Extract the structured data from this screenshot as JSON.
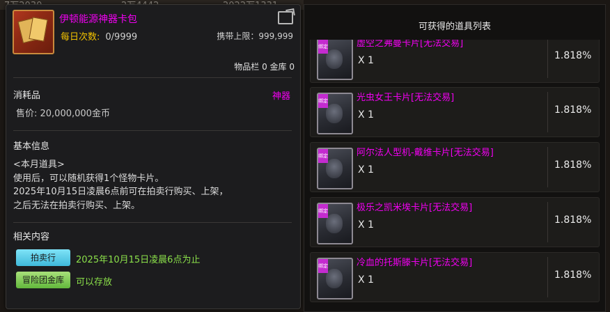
{
  "top_strip": [
    "7万2030",
    "2万4442",
    "2022万1331"
  ],
  "tooltip": {
    "item_name": "伊顿能源神器卡包",
    "item_icon": "card-pack-icon",
    "daily_label": "每日次数:",
    "daily_value": "0/9999",
    "carry_limit": "携带上限：999,999",
    "storage": "物品栏 0 金库 0",
    "category": "消耗品",
    "tag": "神器",
    "price": "售价: 20,000,000金币",
    "basic_info_title": "基本信息",
    "description": [
      "<本月道具>",
      "使用后，可以随机获得1个怪物卡片。",
      "2025年10月15日凌晨6点前可在拍卖行购买、上架，",
      "之后无法在拍卖行购买、上架。"
    ],
    "related_title": "相关内容",
    "auction_button": "拍卖行",
    "auction_note": "2025年10月15日凌晨6点为止",
    "vault_button": "冒险团金库",
    "vault_note": "可以存放"
  },
  "list": {
    "title": "可获得的道具列表",
    "items": [
      {
        "name": "虚空之弗曼卡片[无法交易]",
        "qty": "X 1",
        "pct": "1.818%",
        "badge": "绑定"
      },
      {
        "name": "光虫女王卡片[无法交易]",
        "qty": "X 1",
        "pct": "1.818%",
        "badge": "绑定"
      },
      {
        "name": "阿尔法人型机-戴维卡片[无法交易]",
        "qty": "X 1",
        "pct": "1.818%",
        "badge": "绑定"
      },
      {
        "name": "极乐之凯米埃卡片[无法交易]",
        "qty": "X 1",
        "pct": "1.818%",
        "badge": "绑定"
      },
      {
        "name": "冷血的托斯滕卡片[无法交易]",
        "qty": "X 1",
        "pct": "1.818%",
        "badge": "绑定"
      }
    ]
  },
  "colors": {
    "rare_name": "#f200f2",
    "gold_label": "#f2c200",
    "green_note": "#8be04a",
    "auction_btn": "#3fb9da",
    "vault_btn": "#62b83c"
  }
}
